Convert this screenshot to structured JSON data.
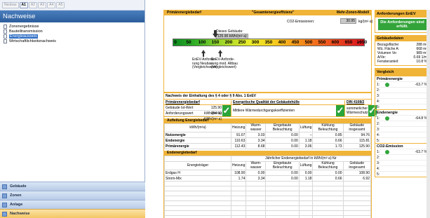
{
  "toolbar": {
    "buttons": [
      "Neubau",
      "A1",
      "A2",
      "A3",
      "A4",
      "A5"
    ]
  },
  "nav": {
    "title": "Nachweise",
    "items": [
      {
        "label": "Zonenergebnisse"
      },
      {
        "label": "Bauteiltransmission"
      },
      {
        "label": "Energieausweis"
      },
      {
        "label": "Wirtschaftlichkeitsnachweis"
      }
    ],
    "bottom": [
      {
        "label": "Gebäude"
      },
      {
        "label": "Zonen"
      },
      {
        "label": "Anlage"
      },
      {
        "label": "Nachweise"
      }
    ]
  },
  "primaer": {
    "title": "Primärenergiebedarf",
    "subtitle": "\"Gesamtenergieeffizienz\"",
    "model": "Mehr-Zonen-Modell",
    "co2_label": "CO2-Emissionen:",
    "co2_value": "30.95",
    "co2_unit": "kg/(m²·a)",
    "dieses_label": "Dieses Gebäude:",
    "dieses_value": "125.90 kWh/(m²·a)",
    "scale_ticks": [
      "0",
      "50",
      "100",
      "150",
      "200",
      "250",
      "300",
      "350",
      "400",
      "450",
      "500",
      "550",
      "600",
      "650",
      "≥650"
    ],
    "anf_neu": [
      "EnEV-Anforde-",
      "rung Neubau",
      "(Vergleichswert)"
    ],
    "anf_alt": [
      "EnEV-Anforde-",
      "rung mod. Altbau",
      "(Vergleichswert)"
    ]
  },
  "nachweis": {
    "title": "Nachweis der Einhaltung des § 4 oder § 9 Abs. 1 EnEV",
    "col1": "Primärenergiebedarf",
    "col2": "Energetische Qualität der Gebäudehülle",
    "col3": "DIN 4108/2",
    "ist_label": "Gebäude Ist-Wert",
    "ist_value": "125.90 kWh/(m²·a)",
    "anf_label": "Anforderungswert",
    "anf_value": "164.69 kWh/(m²·a)",
    "check": "✓",
    "mid_text": "Mittlere Wärmedurchgangskoeffizienten",
    "right_text": [
      "sommerlicher",
      "Wärmeschutz"
    ]
  },
  "aufteilung": {
    "title": "Aufteilung Energiebedarf",
    "headers": [
      "kWh/(m²a)",
      "Heizung",
      "Warm-wasser",
      "Eingebaute Beleuchtung",
      "Lüftung",
      "Kühlung Beleuchtung",
      "Gebäude insgesamt"
    ],
    "rows": [
      [
        "Nutzenergie",
        "91.07",
        "3.03",
        "0.00",
        "–",
        "0.85",
        "94.76"
      ],
      [
        "Endenergie",
        "110.63",
        "3.34",
        "0.00",
        "1.18",
        "0.66",
        "115.81"
      ],
      [
        "Primärenergie",
        "112.43",
        "8.68",
        "0.00",
        "3.06",
        "1.73",
        "125.90"
      ]
    ]
  },
  "endenergie": {
    "title": "Endenergiebedarf",
    "span_header": "Jährlicher Endenergiebedarf in kWh/(m²·a) für",
    "headers": [
      "Energieträger",
      "Heizung",
      "Warm-wasser",
      "Eingebaute Beleuchtung",
      "Lüftung",
      "Kühlung Beleuchtung",
      "Gebäude insgesamt"
    ],
    "rows": [
      [
        "Erdgas H",
        "108.90",
        "0.00",
        "0.00",
        "0.00",
        "0.00",
        "108.90"
      ],
      [
        "Strom-Mix",
        "1.74",
        "3.34",
        "0.00",
        "1.18",
        "0.66",
        "6.92"
      ]
    ]
  },
  "anforderungen": {
    "title": "Anforderungen EnEV",
    "status": "Die Anforderungen sind erfüllt."
  },
  "gebaeude": {
    "title": "Gebäudedaten",
    "rows": [
      {
        "k": "Bezugsfläche:",
        "v": "288 m²"
      },
      {
        "k": "Wü. Fläche A:",
        "v": "668 m²"
      },
      {
        "k": "Volumen Ve:",
        "v": "989 m³"
      },
      {
        "k": "A/Ve:",
        "v": "0.69 1/m"
      },
      {
        "k": "Fensteranteil:",
        "v": "10.8 %"
      }
    ]
  },
  "vergleich": {
    "title": "Vergleich",
    "groups": [
      {
        "name": "Primärenergie",
        "rows": [
          {
            "n": "1:",
            "pct": "-63.7 %"
          },
          {
            "n": "2:",
            "pct": ""
          },
          {
            "n": "3:",
            "pct": ""
          },
          {
            "n": "4:",
            "pct": ""
          },
          {
            "n": "5:",
            "pct": ""
          }
        ]
      },
      {
        "name": "Endenergie",
        "rows": [
          {
            "n": "1:",
            "pct": "-64.8 %"
          },
          {
            "n": "2:",
            "pct": ""
          },
          {
            "n": "3:",
            "pct": ""
          },
          {
            "n": "4:",
            "pct": ""
          },
          {
            "n": "5:",
            "pct": ""
          }
        ]
      },
      {
        "name": "CO2-Emission",
        "rows": [
          {
            "n": "1:",
            "pct": "-63.7 %"
          },
          {
            "n": "2:",
            "pct": ""
          },
          {
            "n": "3:",
            "pct": ""
          },
          {
            "n": "4:",
            "pct": ""
          },
          {
            "n": "5:",
            "pct": ""
          }
        ]
      }
    ]
  },
  "colors": {
    "accent": "#f0b439",
    "ok": "#33a43a",
    "nav": "#2c5d9c"
  }
}
